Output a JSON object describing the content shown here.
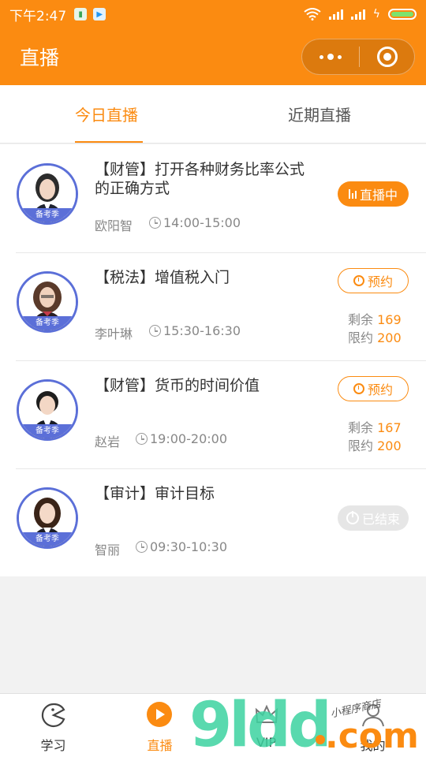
{
  "status_bar": {
    "time": "下午2:47"
  },
  "header": {
    "title": "直播"
  },
  "tabs": [
    {
      "label": "今日直播",
      "active": true
    },
    {
      "label": "近期直播",
      "active": false
    }
  ],
  "courses": [
    {
      "title": "【财管】打开各种财务比率公式的正确方式",
      "teacher": "欧阳智",
      "time": "14:00-15:00",
      "badge": "备考季",
      "status": "live",
      "action_label": "直播中"
    },
    {
      "title": "【税法】增值税入门",
      "teacher": "李叶琳",
      "time": "15:30-16:30",
      "badge": "备考季",
      "status": "reserve",
      "action_label": "预约",
      "remaining_label": "剩余",
      "remaining": "169",
      "limit_label": "限约",
      "limit": "200"
    },
    {
      "title": "【财管】货币的时间价值",
      "teacher": "赵岩",
      "time": "19:00-20:00",
      "badge": "备考季",
      "status": "reserve",
      "action_label": "预约",
      "remaining_label": "剩余",
      "remaining": "167",
      "limit_label": "限约",
      "limit": "200"
    },
    {
      "title": "【审计】审计目标",
      "teacher": "智丽",
      "time": "09:30-10:30",
      "badge": "备考季",
      "status": "ended",
      "action_label": "已结束"
    }
  ],
  "bottom_nav": [
    {
      "label": "学习",
      "icon": "pacman-icon"
    },
    {
      "label": "直播",
      "icon": "play-icon",
      "active": true
    },
    {
      "label": "VIP",
      "icon": "crown-icon"
    },
    {
      "label": "我的",
      "icon": "user-icon"
    }
  ],
  "watermark": {
    "main": "9ldd",
    "suffix": ".com",
    "script": "小程序商店"
  },
  "colors": {
    "accent": "#fb8b11",
    "avatar_ring": "#5b6fd8"
  }
}
